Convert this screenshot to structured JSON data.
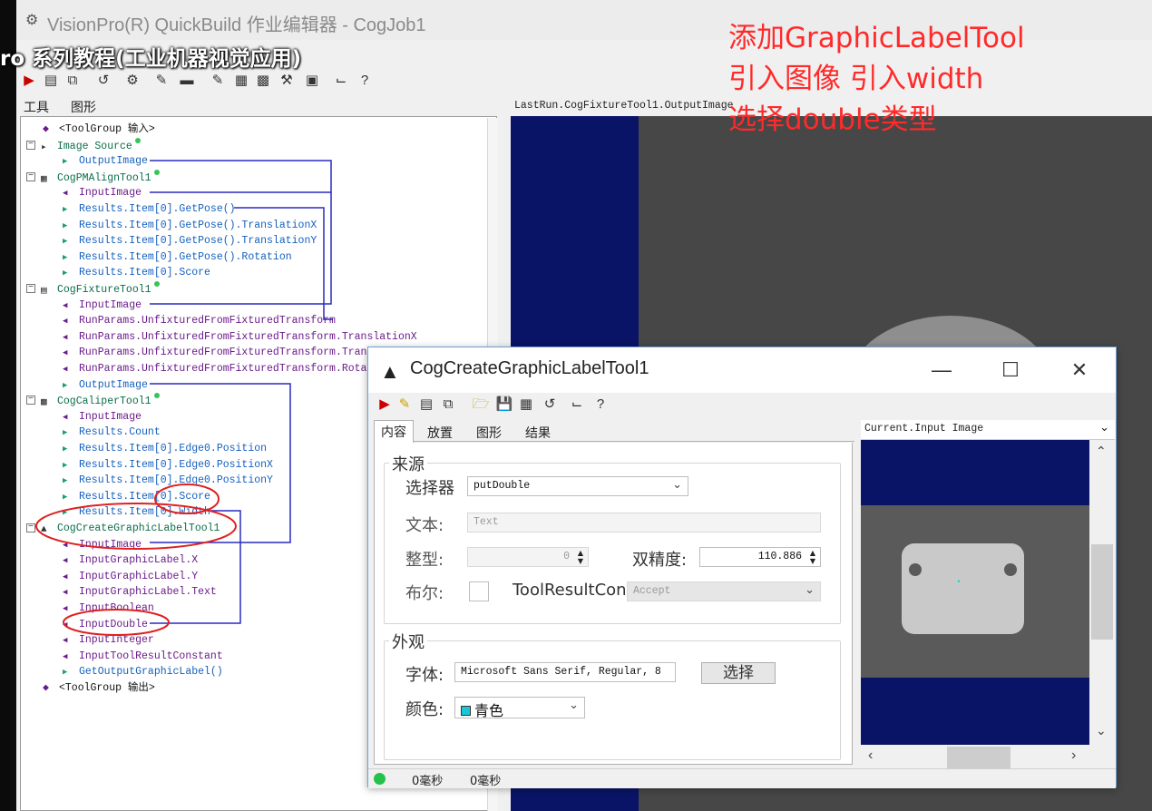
{
  "window": {
    "title": "VisionPro(R) QuickBuild 作业编辑器 - CogJob1",
    "overlay_text": "ro 系列教程(工业机器视觉应用)"
  },
  "panel_tabs": [
    "工具",
    "图形"
  ],
  "tree": {
    "rows": [
      {
        "text": "<ToolGroup 输入>",
        "kind": "group"
      },
      {
        "text": "Image Source",
        "kind": "tool"
      },
      {
        "text": "OutputImage",
        "kind": "out"
      },
      {
        "text": "CogPMAlignTool1",
        "kind": "tool"
      },
      {
        "text": "InputImage",
        "kind": "in"
      },
      {
        "text": "Results.Item[0].GetPose()",
        "kind": "out"
      },
      {
        "text": "Results.Item[0].GetPose().TranslationX",
        "kind": "out"
      },
      {
        "text": "Results.Item[0].GetPose().TranslationY",
        "kind": "out"
      },
      {
        "text": "Results.Item[0].GetPose().Rotation",
        "kind": "out"
      },
      {
        "text": "Results.Item[0].Score",
        "kind": "out"
      },
      {
        "text": "CogFixtureTool1",
        "kind": "tool"
      },
      {
        "text": "InputImage",
        "kind": "in"
      },
      {
        "text": "RunParams.UnfixturedFromFixturedTransform",
        "kind": "in"
      },
      {
        "text": "RunParams.UnfixturedFromFixturedTransform.TranslationX",
        "kind": "in"
      },
      {
        "text": "RunParams.UnfixturedFromFixturedTransform.TranslationY",
        "kind": "in"
      },
      {
        "text": "RunParams.UnfixturedFromFixturedTransform.Rotation",
        "kind": "in"
      },
      {
        "text": "OutputImage",
        "kind": "out"
      },
      {
        "text": "CogCaliperTool1",
        "kind": "tool"
      },
      {
        "text": "InputImage",
        "kind": "in"
      },
      {
        "text": "Results.Count",
        "kind": "out"
      },
      {
        "text": "Results.Item[0].Edge0.Position",
        "kind": "out"
      },
      {
        "text": "Results.Item[0].Edge0.PositionX",
        "kind": "out"
      },
      {
        "text": "Results.Item[0].Edge0.PositionY",
        "kind": "out"
      },
      {
        "text": "Results.Item[0].Score",
        "kind": "out"
      },
      {
        "text": "Results.Item[0].Width",
        "kind": "out"
      },
      {
        "text": "CogCreateGraphicLabelTool1",
        "kind": "tool"
      },
      {
        "text": "InputImage",
        "kind": "in"
      },
      {
        "text": "InputGraphicLabel.X",
        "kind": "in"
      },
      {
        "text": "InputGraphicLabel.Y",
        "kind": "in"
      },
      {
        "text": "InputGraphicLabel.Text",
        "kind": "in"
      },
      {
        "text": "InputBoolean",
        "kind": "in"
      },
      {
        "text": "InputDouble",
        "kind": "in"
      },
      {
        "text": "InputInteger",
        "kind": "in"
      },
      {
        "text": "InputToolResultConstant",
        "kind": "in"
      },
      {
        "text": "GetOutputGraphicLabel()",
        "kind": "out"
      },
      {
        "text": "<ToolGroup 输出>",
        "kind": "group"
      }
    ]
  },
  "display": {
    "label": "LastRun.CogFixtureTool1.OutputImage"
  },
  "annotation": {
    "lines": [
      "添加GraphicLabelTool",
      "引入图像 引入width",
      "选择double类型"
    ]
  },
  "dialog": {
    "title": "CogCreateGraphicLabelTool1",
    "tabs": [
      "内容",
      "放置",
      "图形",
      "结果"
    ],
    "source_group": {
      "title": "来源",
      "selector_label": "选择器",
      "selector_value": "putDouble",
      "text_label": "文本:",
      "text_placeholder": "Text",
      "integer_label": "整型:",
      "integer_value": "0",
      "double_label": "双精度:",
      "double_value": "110.886",
      "boolean_label": "布尔:",
      "result_label": "ToolResultCon",
      "result_value": "Accept"
    },
    "appearance_group": {
      "title": "外观",
      "font_label": "字体:",
      "font_value": "Microsoft Sans Serif, Regular, 8",
      "choose_button": "选择",
      "color_label": "颜色:",
      "color_value": "青色"
    },
    "image_label": "Current.Input Image",
    "status": [
      "0毫秒",
      "0毫秒"
    ]
  },
  "colors": {
    "input_arrow": "#6a1b8a",
    "output_arrow": "#1f9a7a",
    "link_line": "#2a2ac0",
    "annotation": "#ff2a2a",
    "color_swatch": "#19c8d8"
  }
}
